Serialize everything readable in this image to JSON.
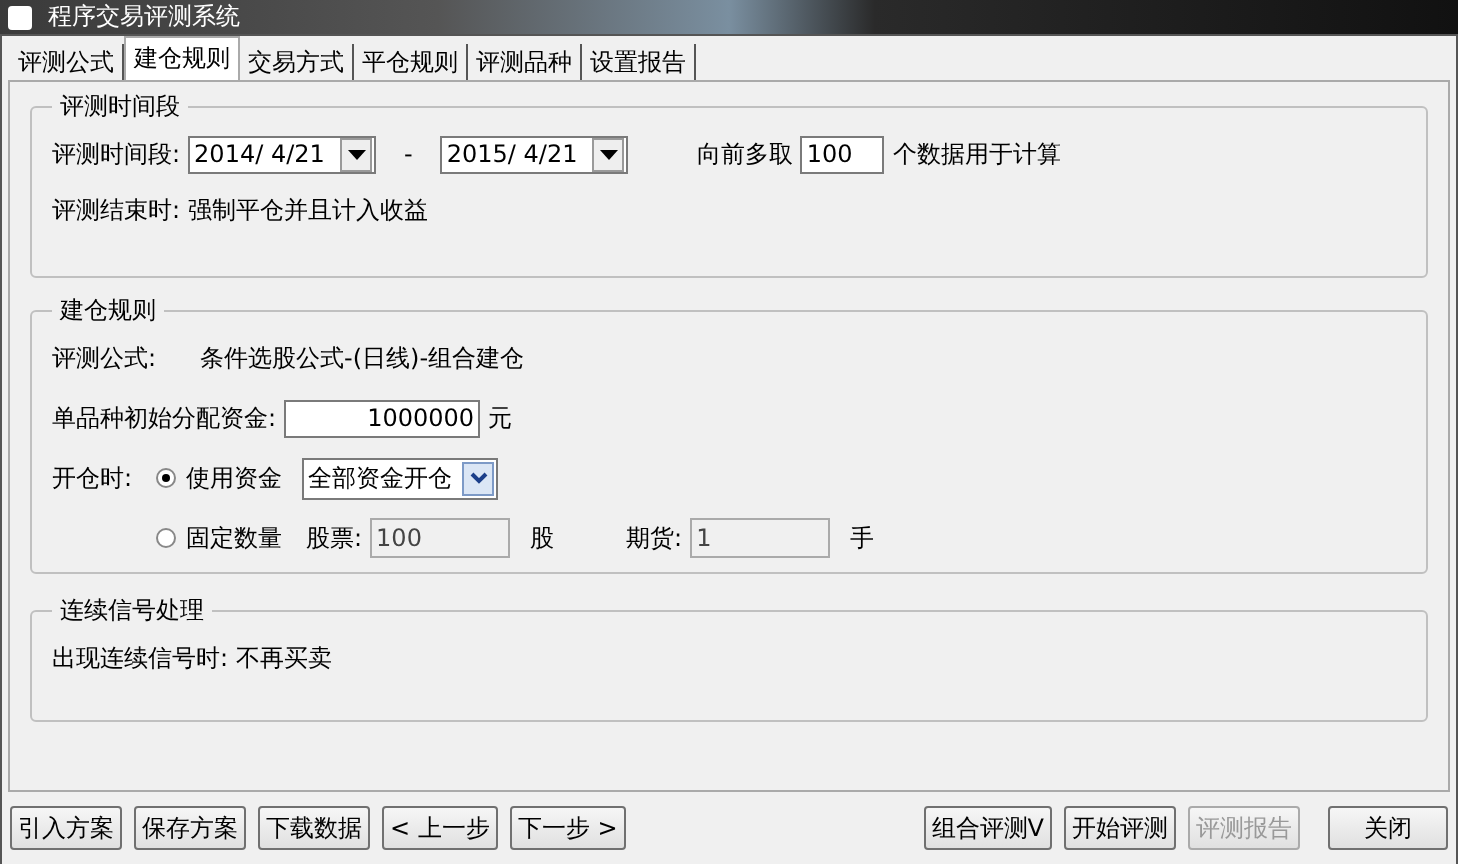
{
  "window": {
    "title": "程序交易评测系统"
  },
  "tabs": [
    {
      "label": "评测公式",
      "selected": false
    },
    {
      "label": "建仓规则",
      "selected": true
    },
    {
      "label": "交易方式",
      "selected": false
    },
    {
      "label": "平仓规则",
      "selected": false
    },
    {
      "label": "评测品种",
      "selected": false
    },
    {
      "label": "设置报告",
      "selected": false
    }
  ],
  "time_group": {
    "title": "评测时间段",
    "label": "评测时间段:",
    "start_date": "2014/ 4/21",
    "separator": "-",
    "end_date": "2015/ 4/21",
    "prefetch_label": "向前多取",
    "prefetch_value": "100",
    "prefetch_suffix": "个数据用于计算",
    "end_label": "评测结束时:",
    "end_value": "强制平仓并且计入收益"
  },
  "build_group": {
    "title": "建仓规则",
    "formula_label": "评测公式:",
    "formula_value": "条件选股公式-(日线)-组合建仓",
    "capital_label": "单品种初始分配资金:",
    "capital_value": "1000000",
    "capital_unit": "元",
    "open_label": "开仓时:",
    "options": [
      {
        "label": "使用资金",
        "selected": true
      },
      {
        "label": "固定数量",
        "selected": false
      }
    ],
    "fund_mode": "全部资金开仓",
    "quantity_fields": [
      {
        "label": "股票:",
        "value": "100",
        "unit": "股",
        "disabled": true
      },
      {
        "label": "期货:",
        "value": "1",
        "unit": "手",
        "disabled": true
      }
    ]
  },
  "signal_group": {
    "title": "连续信号处理",
    "label": "出现连续信号时:",
    "value": "不再买卖"
  },
  "buttons": [
    {
      "label": "引入方案",
      "disabled": false
    },
    {
      "label": "保存方案",
      "disabled": false
    },
    {
      "label": "下载数据",
      "disabled": false
    },
    {
      "label": "< 上一步",
      "disabled": false
    },
    {
      "label": "下一步 >",
      "disabled": false
    },
    {
      "label": "组合评测V",
      "disabled": false
    },
    {
      "label": "开始评测",
      "disabled": false
    },
    {
      "label": "评测报告",
      "disabled": true
    },
    {
      "label": "关闭",
      "disabled": false
    }
  ]
}
